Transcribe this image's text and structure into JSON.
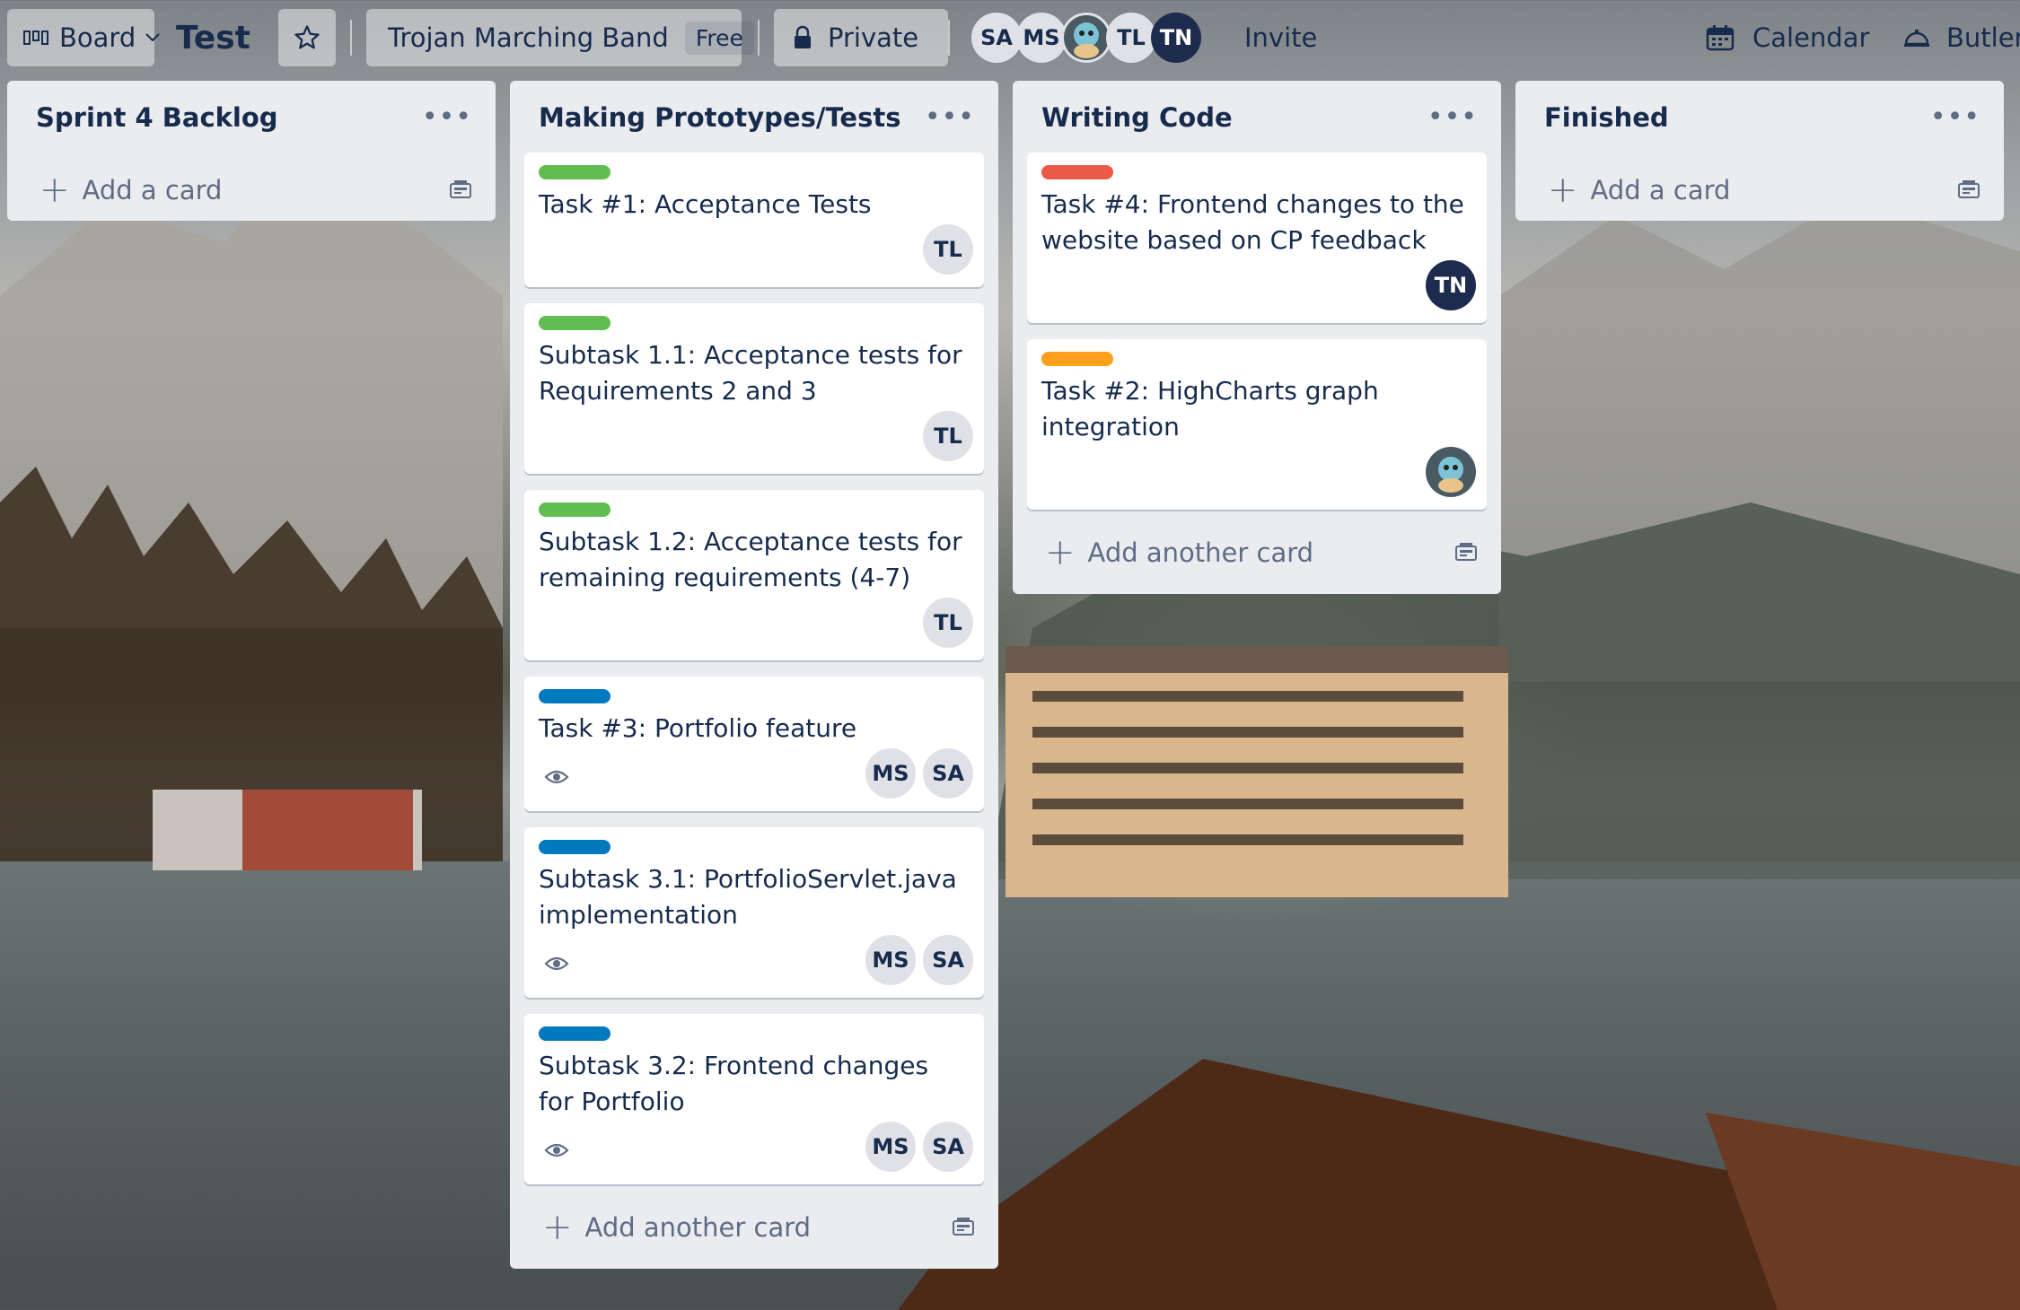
{
  "colors": {
    "label_green": "#61bd4f",
    "label_red": "#eb5a46",
    "label_orange": "#ff9f1a",
    "label_blue": "#0079bf",
    "member_dark": "#1d2b4f",
    "member_light": "#dfe1e6",
    "list_bg": "#ebecf0"
  },
  "header": {
    "board_switcher": {
      "icon": "board-icon",
      "label": "Board"
    },
    "board_title": "Test",
    "star_icon": "star-icon",
    "team": {
      "name": "Trojan Marching Band",
      "badge": "Free"
    },
    "visibility": {
      "icon": "lock-icon",
      "label": "Private"
    },
    "members": [
      "SA",
      "MS",
      "",
      "TL",
      "TN"
    ],
    "invite_label": "Invite",
    "calendar": {
      "icon": "calendar-icon",
      "label": "Calendar"
    },
    "butler": {
      "icon": "butler-icon",
      "label": "Butler"
    }
  },
  "lists": [
    {
      "title": "Sprint 4 Backlog",
      "add_label": "Add a card",
      "cards": []
    },
    {
      "title": "Making Prototypes/Tests",
      "add_label": "Add another card",
      "cards": [
        {
          "label_color": "green",
          "title": "Task #1: Acceptance Tests",
          "members": [
            "TL"
          ],
          "watch": false
        },
        {
          "label_color": "green",
          "title": "Subtask 1.1: Acceptance tests for Requirements 2 and 3",
          "members": [
            "TL"
          ],
          "watch": false
        },
        {
          "label_color": "green",
          "title": "Subtask 1.2: Acceptance tests for remaining requirements (4-7)",
          "members": [
            "TL"
          ],
          "watch": false
        },
        {
          "label_color": "blue",
          "title": "Task #3: Portfolio feature",
          "members": [
            "MS",
            "SA"
          ],
          "watch": true
        },
        {
          "label_color": "blue",
          "title": "Subtask 3.1: PortfolioServlet.java implementation",
          "members": [
            "MS",
            "SA"
          ],
          "watch": true
        },
        {
          "label_color": "blue",
          "title": "Subtask 3.2: Frontend changes for Portfolio",
          "members": [
            "MS",
            "SA"
          ],
          "watch": true
        }
      ]
    },
    {
      "title": "Writing Code",
      "add_label": "Add another card",
      "cards": [
        {
          "label_color": "red",
          "title": "Task #4: Frontend changes to the website based on CP feedback",
          "members": [
            "TN"
          ],
          "watch": false
        },
        {
          "label_color": "orange",
          "title": "Task #2: HighCharts graph integration",
          "members": [
            ""
          ],
          "watch": false
        }
      ]
    },
    {
      "title": "Finished",
      "add_label": "Add a card",
      "cards": []
    }
  ]
}
